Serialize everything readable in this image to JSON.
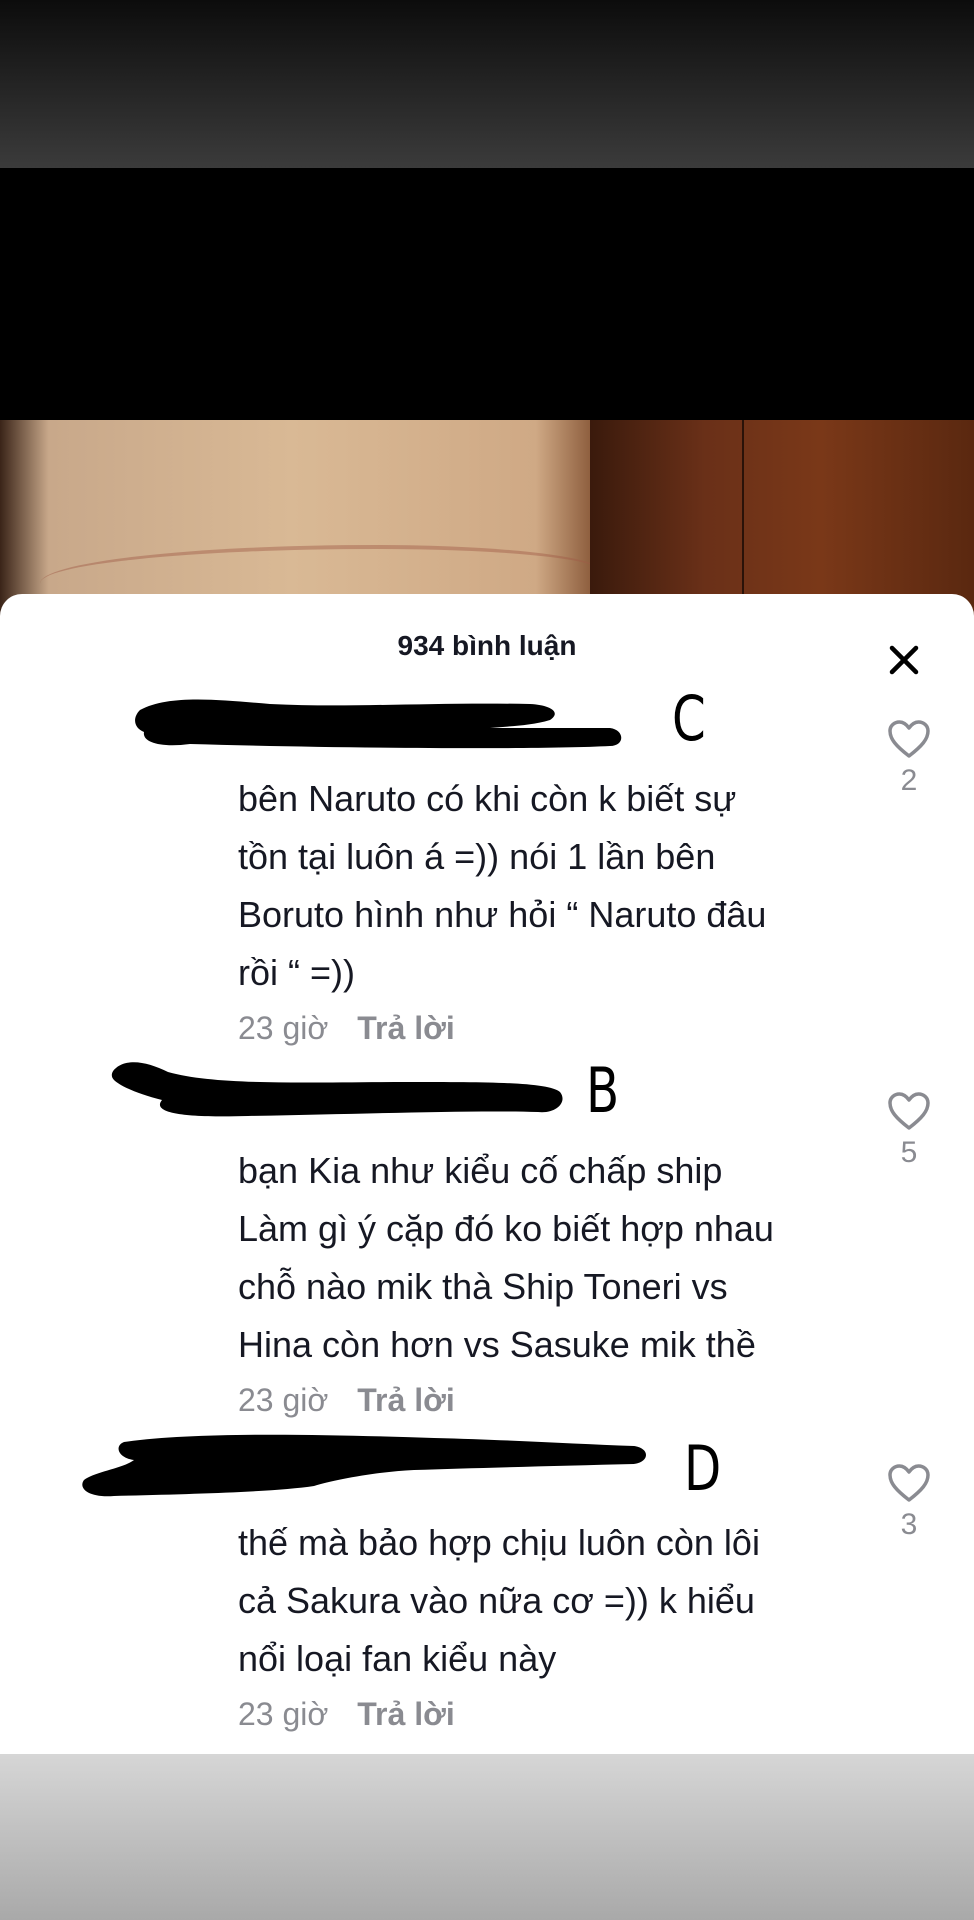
{
  "comments_panel": {
    "title": "934 bình luận",
    "close_icon": "close-icon"
  },
  "comments": [
    {
      "annotation": "C",
      "text": "bên Naruto có khi còn k biết sự\ntồn tại luôn á =)) nói 1 lần bên\nBoruto hình như hỏi “ Naruto đâu\nrồi “ =))",
      "time": "23 giờ",
      "reply_label": "Trả lời",
      "likes": "2"
    },
    {
      "annotation": "B",
      "text": "bạn Kia như kiểu cố chấp ship\nLàm gì ý cặp đó ko biết hợp nhau\nchỗ nào mik thà Ship Toneri vs\nHina còn hơn vs Sasuke mik thề",
      "time": "23 giờ",
      "reply_label": "Trả lời",
      "likes": "5"
    },
    {
      "annotation": "D",
      "text": "thế mà bảo hợp chịu luôn còn lôi\ncả Sakura vào nữa cơ =)) k hiểu\nnổi loại fan kiểu này",
      "time": "23 giờ",
      "reply_label": "Trả lời",
      "likes": "3"
    }
  ],
  "colors": {
    "panel": "#ffffff",
    "text": "#161823",
    "muted": "#8a8b91",
    "redaction": "#000000"
  }
}
